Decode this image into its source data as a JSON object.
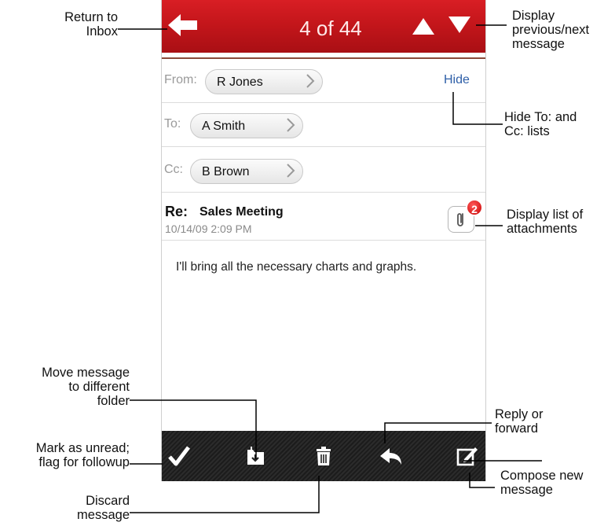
{
  "titlebar": {
    "counter": "4 of 44"
  },
  "header": {
    "from_label": "From:",
    "from_value": "R Jones",
    "to_label": "To:",
    "to_value": "A Smith",
    "cc_label": "Cc:",
    "cc_value": "B Brown",
    "hide_label": "Hide"
  },
  "message": {
    "subject_prefix": "Re:",
    "subject": "Sales Meeting",
    "date": "10/14/09 2:09 PM",
    "attachment_count": "2",
    "body": "I'll bring all the necessary charts and graphs."
  },
  "annotations": {
    "return_inbox": [
      "Return to",
      "Inbox"
    ],
    "prev_next": [
      "Display",
      "previous/next",
      "message"
    ],
    "hide_lists": [
      "Hide To: and",
      "Cc: lists"
    ],
    "attachments": [
      "Display list of",
      "attachments"
    ],
    "move_folder": [
      "Move message",
      "to different",
      "folder"
    ],
    "mark_unread": [
      "Mark as unread;",
      "flag for followup"
    ],
    "discard": [
      "Discard",
      "message"
    ],
    "reply": [
      "Reply or",
      "forward"
    ],
    "compose": [
      "Compose new",
      "message"
    ]
  },
  "icons": [
    "back-arrow-icon",
    "up-triangle-icon",
    "down-triangle-icon",
    "chevron-right-icon",
    "paperclip-icon",
    "checkmark-icon",
    "move-folder-icon",
    "trash-icon",
    "reply-icon",
    "compose-icon"
  ]
}
